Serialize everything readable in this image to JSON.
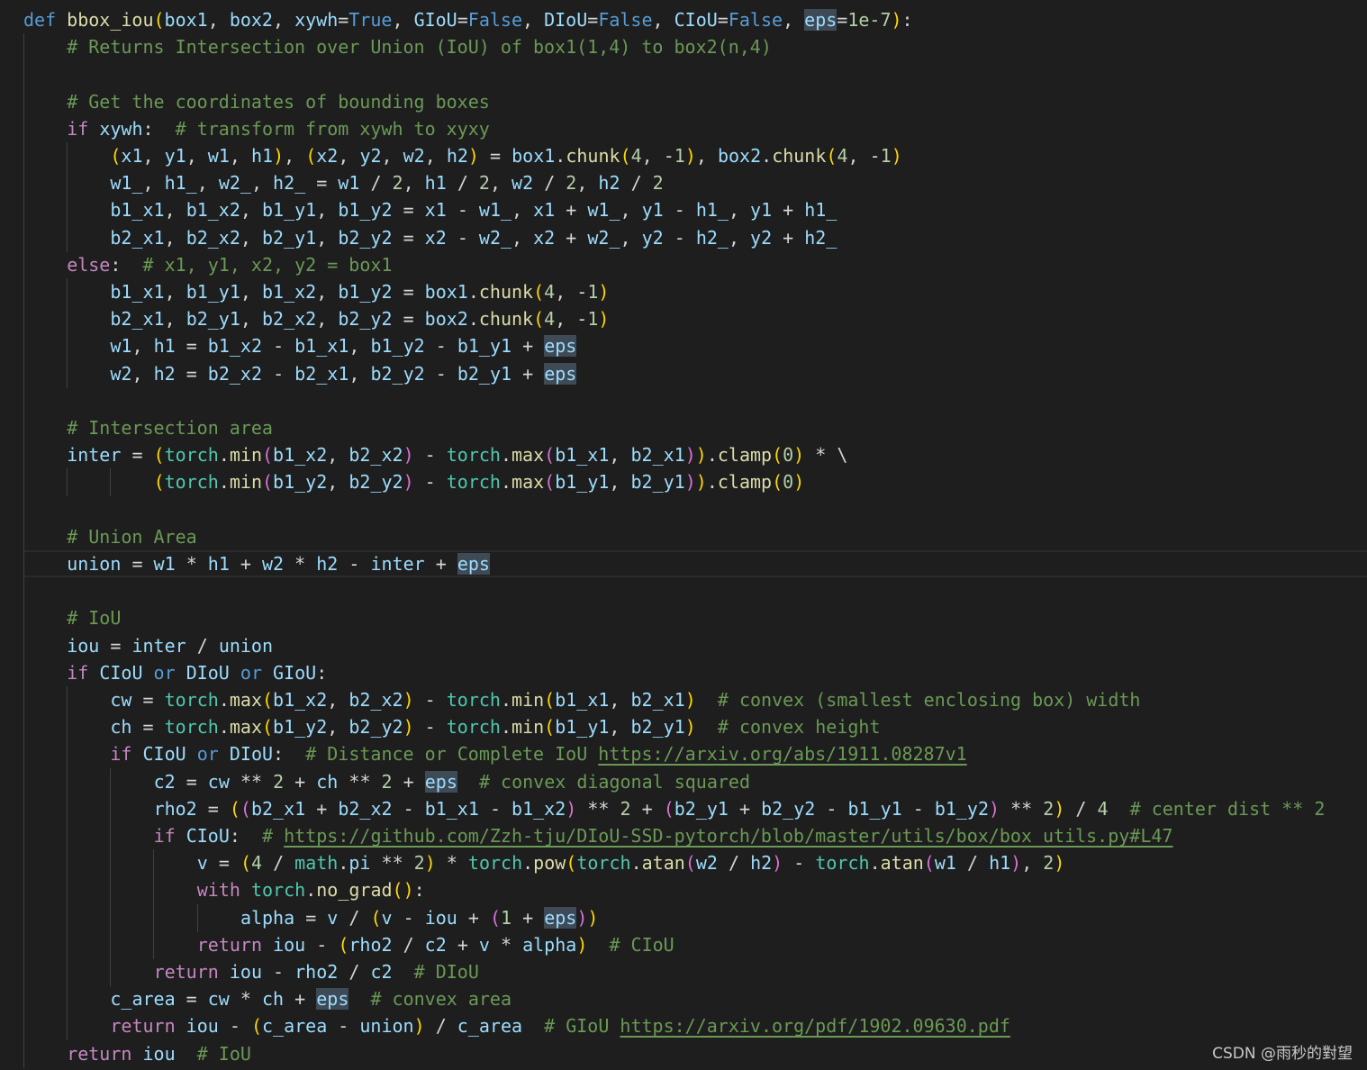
{
  "editor": {
    "lines": [
      "def bbox_iou(box1, box2, xywh=True, GIoU=False, DIoU=False, CIoU=False, eps=1e-7):",
      "    # Returns Intersection over Union (IoU) of box1(1,4) to box2(n,4)",
      "",
      "    # Get the coordinates of bounding boxes",
      "    if xywh:  # transform from xywh to xyxy",
      "        (x1, y1, w1, h1), (x2, y2, w2, h2) = box1.chunk(4, -1), box2.chunk(4, -1)",
      "        w1_, h1_, w2_, h2_ = w1 / 2, h1 / 2, w2 / 2, h2 / 2",
      "        b1_x1, b1_x2, b1_y1, b1_y2 = x1 - w1_, x1 + w1_, y1 - h1_, y1 + h1_",
      "        b2_x1, b2_x2, b2_y1, b2_y2 = x2 - w2_, x2 + w2_, y2 - h2_, y2 + h2_",
      "    else:  # x1, y1, x2, y2 = box1",
      "        b1_x1, b1_y1, b1_x2, b1_y2 = box1.chunk(4, -1)",
      "        b2_x1, b2_y1, b2_x2, b2_y2 = box2.chunk(4, -1)",
      "        w1, h1 = b1_x2 - b1_x1, b1_y2 - b1_y1 + eps",
      "        w2, h2 = b2_x2 - b2_x1, b2_y2 - b2_y1 + eps",
      "",
      "    # Intersection area",
      "    inter = (torch.min(b1_x2, b2_x2) - torch.max(b1_x1, b2_x1)).clamp(0) * \\",
      "            (torch.min(b1_y2, b2_y2) - torch.max(b1_y1, b2_y1)).clamp(0)",
      "",
      "    # Union Area",
      "    union = w1 * h1 + w2 * h2 - inter + eps",
      "",
      "    # IoU",
      "    iou = inter / union",
      "    if CIoU or DIoU or GIoU:",
      "        cw = torch.max(b1_x2, b2_x2) - torch.min(b1_x1, b2_x1)  # convex (smallest enclosing box) width",
      "        ch = torch.max(b1_y2, b2_y2) - torch.min(b1_y1, b2_y1)  # convex height",
      "        if CIoU or DIoU:  # Distance or Complete IoU https://arxiv.org/abs/1911.08287v1",
      "            c2 = cw ** 2 + ch ** 2 + eps  # convex diagonal squared",
      "            rho2 = ((b2_x1 + b2_x2 - b1_x1 - b1_x2) ** 2 + (b2_y1 + b2_y2 - b1_y1 - b1_y2) ** 2) / 4  # center dist ** 2",
      "            if CIoU:  # https://github.com/Zzh-tju/DIoU-SSD-pytorch/blob/master/utils/box/box_utils.py#L47",
      "                v = (4 / math.pi ** 2) * torch.pow(torch.atan(w2 / h2) - torch.atan(w1 / h1), 2)",
      "                with torch.no_grad():",
      "                    alpha = v / (v - iou + (1 + eps))",
      "                return iou - (rho2 / c2 + v * alpha)  # CIoU",
      "            return iou - rho2 / c2  # DIoU",
      "        c_area = cw * ch + eps  # convex area",
      "        return iou - (c_area - union) / c_area  # GIoU https://arxiv.org/pdf/1902.09630.pdf",
      "    return iou  # IoU"
    ]
  },
  "watermark": "CSDN @雨秒的對望",
  "colors": {
    "background": "#1e1e1e",
    "keyword": "#569cd6",
    "control": "#c586c0",
    "function": "#dcdcaa",
    "variable": "#9cdcfe",
    "number": "#b5cea8",
    "module": "#4ec9b0",
    "comment": "#6a9955"
  }
}
